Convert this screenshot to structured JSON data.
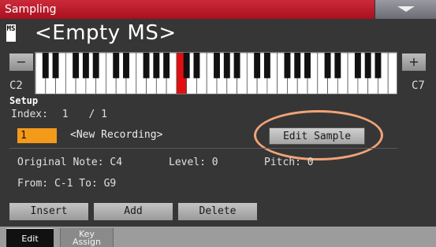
{
  "window": {
    "title": "Sampling"
  },
  "header": {
    "type_tag": "MS",
    "sample_name": "<Empty MS>"
  },
  "keyboard": {
    "range_low": "C2",
    "range_high": "C7",
    "minus_label": "−",
    "plus_label": "+",
    "selected_key_color": "#e01010"
  },
  "setup": {
    "label": "Setup",
    "index_label": "Index:",
    "index_value": "1",
    "index_total": "/ 1",
    "recording_number": "1",
    "recording_name": "<New Recording>",
    "edit_sample_label": "Edit Sample",
    "highlight_color": "#f0a478",
    "original_note": "Original Note: C4",
    "level": "Level: 0",
    "pitch": "Pitch: 0",
    "from_to": "From:  C-1   To:  G9"
  },
  "actions": {
    "insert": "Insert",
    "add": "Add",
    "delete": "Delete"
  },
  "tabs": [
    {
      "label": "Edit"
    },
    {
      "label": "Key\nAssign"
    }
  ],
  "colors": {
    "title_bar": "#b81a28",
    "recording_highlight": "#f39a1b"
  }
}
